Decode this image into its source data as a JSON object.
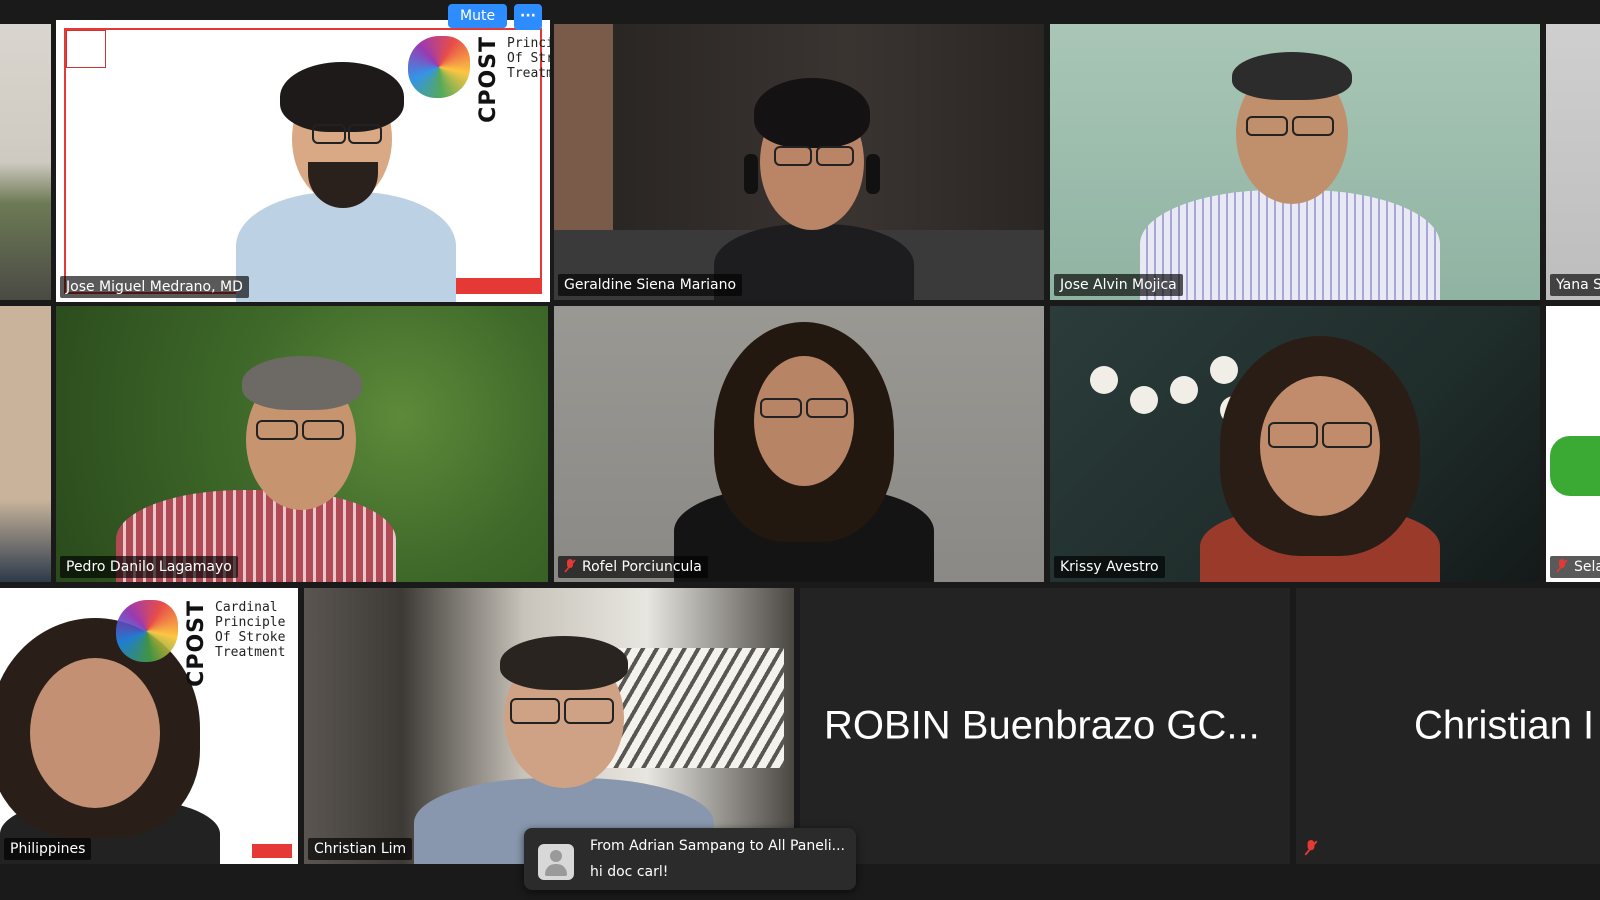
{
  "controls": {
    "mute_label": "Mute",
    "more_label": "···"
  },
  "banner": {
    "word": "CPOST",
    "lines": [
      "Cardinal",
      "Principle",
      "Of Stroke",
      "Treatment"
    ]
  },
  "participants": {
    "p1": {
      "name": "Jose Miguel Medrano, MD",
      "active_speaker": true
    },
    "p2": {
      "name": "Geraldine Siena Mariano"
    },
    "p3": {
      "name": "Jose Alvin Mojica"
    },
    "p4": {
      "name": "Yana S"
    },
    "p5": {
      "name": "Pedro Danilo Lagamayo"
    },
    "p6": {
      "name": "Rofel Porciuncula",
      "muted": true
    },
    "p7": {
      "name": "Krissy Avestro"
    },
    "p8": {
      "name": "Sela",
      "muted": true
    },
    "p9": {
      "name": "Philippines"
    },
    "p10": {
      "name": "Christian Lim"
    },
    "p11": {
      "name": "ROBIN Buenbrazo GC..."
    },
    "p12": {
      "name": "Christian I",
      "muted": true
    }
  },
  "chat": {
    "from": "From Adrian Sampang to All Paneli...",
    "message": "hi doc carl!"
  },
  "colors": {
    "accent": "#2d8cff",
    "active_speaker_border": "#e4d87a",
    "muted_icon": "#e53935"
  }
}
